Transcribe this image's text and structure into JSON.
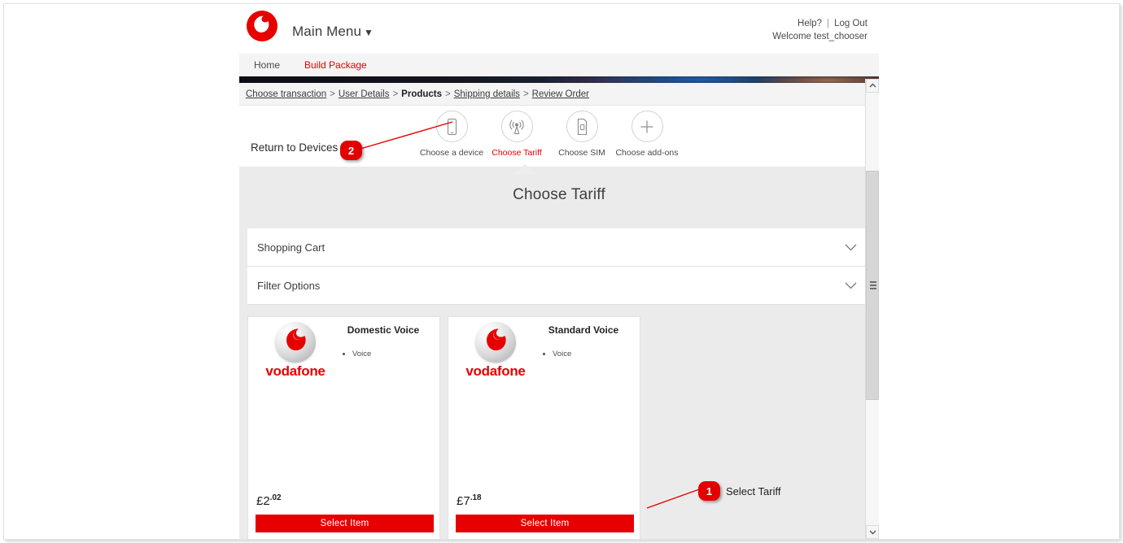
{
  "header": {
    "logo_icon": "vodafone-logo-icon",
    "main_menu_label": "Main Menu",
    "caret": "▼",
    "help_label": "Help?",
    "separator": "|",
    "logout_label": "Log Out",
    "welcome_text": "Welcome test_chooser"
  },
  "nav": {
    "items": [
      {
        "label": "Home",
        "active": false
      },
      {
        "label": "Build Package",
        "active": true
      }
    ]
  },
  "breadcrumb": {
    "separator": ">",
    "items": [
      {
        "label": "Choose transaction",
        "active": false
      },
      {
        "label": "User Details",
        "active": false
      },
      {
        "label": "Products",
        "active": true
      },
      {
        "label": "Shipping details",
        "active": false
      },
      {
        "label": "Review Order",
        "active": false
      }
    ]
  },
  "steps": {
    "return_label": "Return to Devices",
    "items": [
      {
        "label": "Choose a device",
        "icon": "mobile-phone-icon",
        "current": false
      },
      {
        "label": "Choose Tariff",
        "icon": "signal-antenna-icon",
        "current": true
      },
      {
        "label": "Choose SIM",
        "icon": "sim-card-icon",
        "current": false
      },
      {
        "label": "Choose add-ons",
        "icon": "plus-icon",
        "current": false
      }
    ]
  },
  "panel": {
    "title": "Choose Tariff",
    "accordions": [
      {
        "label": "Shopping Cart",
        "icon": "chevron-down-icon"
      },
      {
        "label": "Filter Options",
        "icon": "chevron-down-icon"
      }
    ]
  },
  "products": [
    {
      "title": "Domestic Voice",
      "brand": "vodafone",
      "features": [
        "Voice"
      ],
      "price_major": "£2",
      "price_minor": ".02",
      "button_label": "Select Item"
    },
    {
      "title": "Standard Voice",
      "brand": "vodafone",
      "features": [
        "Voice"
      ],
      "price_major": "£7",
      "price_minor": ".18",
      "button_label": "Select Item"
    }
  ],
  "annotations": [
    {
      "number": "1",
      "text": "Select Tariff"
    },
    {
      "number": "2",
      "text": ""
    }
  ],
  "scrollbar": {
    "up_icon": "chevron-up-icon",
    "down_icon": "chevron-down-icon",
    "grip_icon": "grip-lines-icon"
  },
  "colors": {
    "brand_red": "#e60000",
    "annotation_red": "#e20000",
    "panel_grey": "#ebebeb",
    "nav_grey": "#f4f4f4"
  }
}
